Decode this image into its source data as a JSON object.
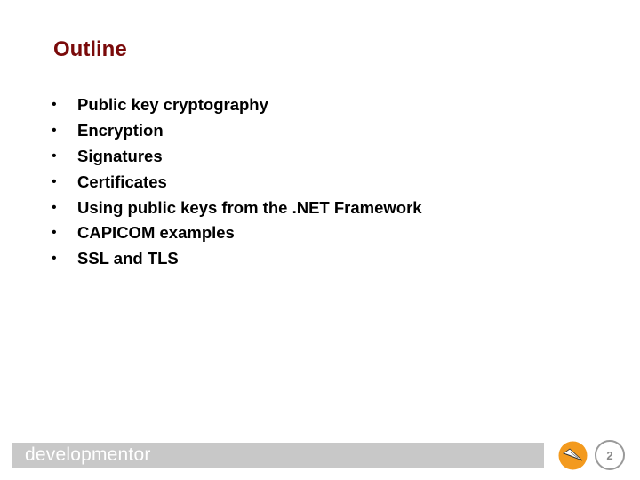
{
  "slide": {
    "title": "Outline",
    "bullet_glyph": "•",
    "bullets": [
      "Public key cryptography",
      "Encryption",
      "Signatures",
      "Certificates",
      "Using public keys from the .NET Framework",
      "CAPICOM examples",
      "SSL and TLS"
    ]
  },
  "footer": {
    "brand": "developmentor",
    "logo_icon": "paper-plane-icon",
    "page_number": "2",
    "colors": {
      "bar": "#c8c8c8",
      "logo": "#f39a1e",
      "title": "#7a0a0a"
    }
  }
}
